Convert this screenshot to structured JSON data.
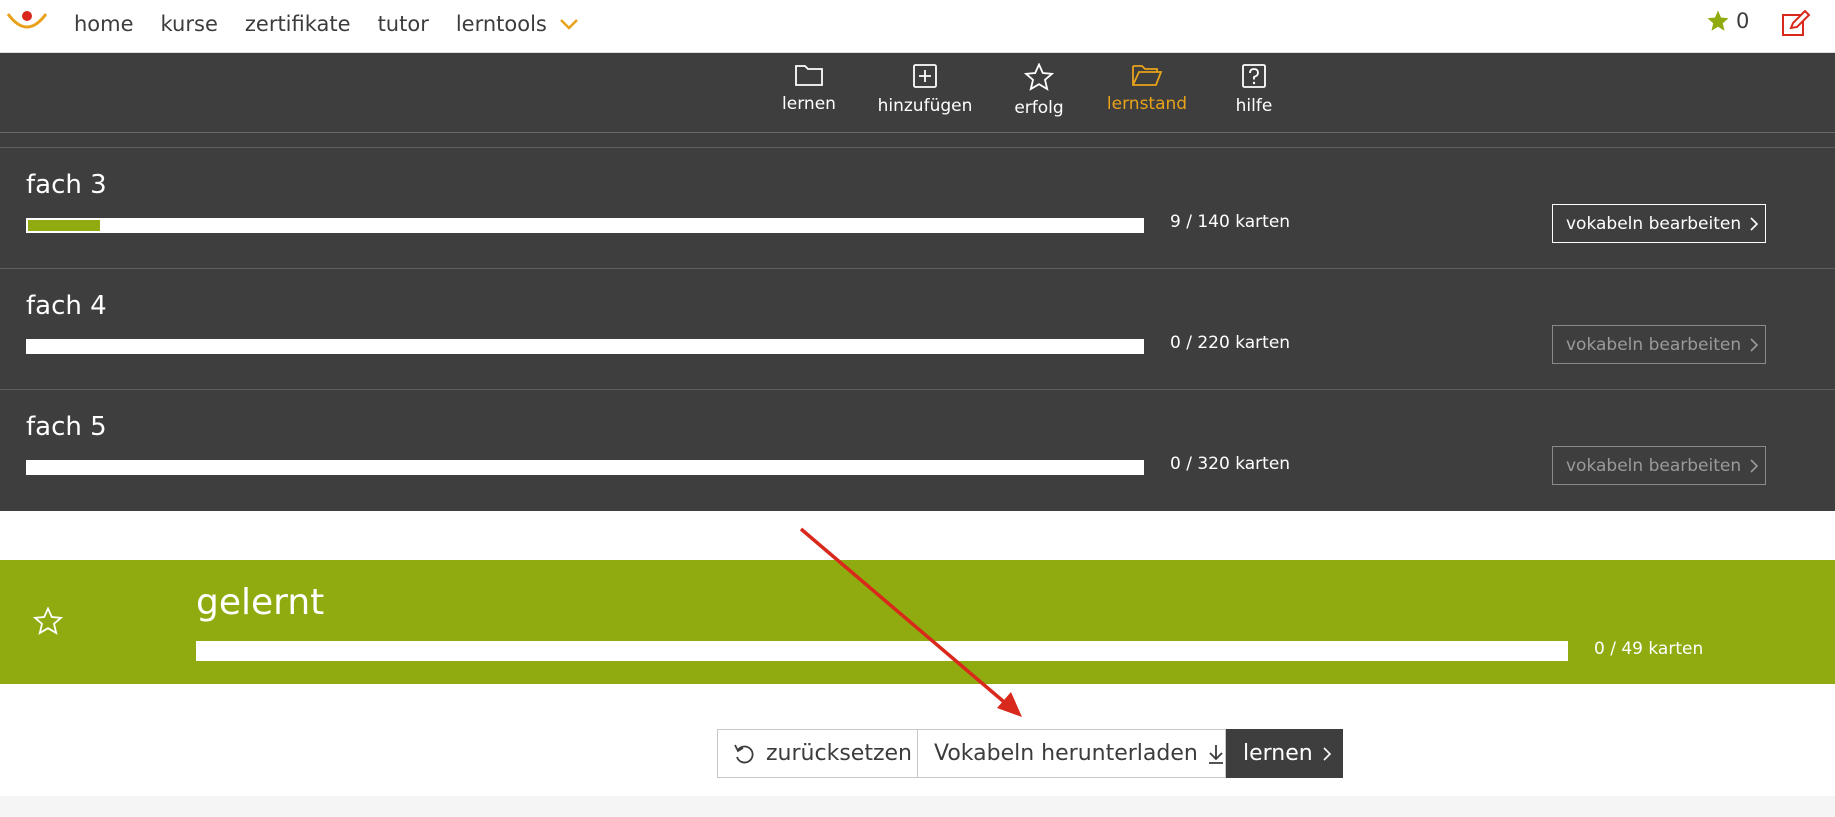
{
  "topnav": {
    "items": [
      {
        "label": "home"
      },
      {
        "label": "kurse"
      },
      {
        "label": "zertifikate"
      },
      {
        "label": "tutor"
      }
    ],
    "dropdown_label": "lerntools",
    "star_count": "0"
  },
  "toolbar": {
    "tools": [
      {
        "label": "lernen",
        "icon": "folder-icon"
      },
      {
        "label": "hinzufügen",
        "icon": "plus-square-icon"
      },
      {
        "label": "erfolg",
        "icon": "star-icon"
      },
      {
        "label": "lernstand",
        "icon": "folder-open-icon",
        "active": true
      },
      {
        "label": "hilfe",
        "icon": "help-square-icon"
      }
    ]
  },
  "stages": [
    {
      "title": "fach 3",
      "count": "9 / 140 karten",
      "progress": 0.064,
      "button": "vokabeln bearbeiten",
      "enabled": true
    },
    {
      "title": "fach 4",
      "count": "0 / 220 karten",
      "progress": 0,
      "button": "vokabeln bearbeiten",
      "enabled": false
    },
    {
      "title": "fach 5",
      "count": "0 / 320 karten",
      "progress": 0,
      "button": "vokabeln bearbeiten",
      "enabled": false
    }
  ],
  "learned": {
    "title": "gelernt",
    "count": "0 / 49 karten",
    "progress": 0
  },
  "actions": {
    "reset": "zurücksetzen",
    "download": "Vokabeln herunterladen",
    "learn": "lernen"
  },
  "colors": {
    "accent_green": "#8fab10",
    "active_orange": "#e8a21a",
    "dark_panel": "#3e3e3e",
    "annotation_red": "#d9291c"
  }
}
